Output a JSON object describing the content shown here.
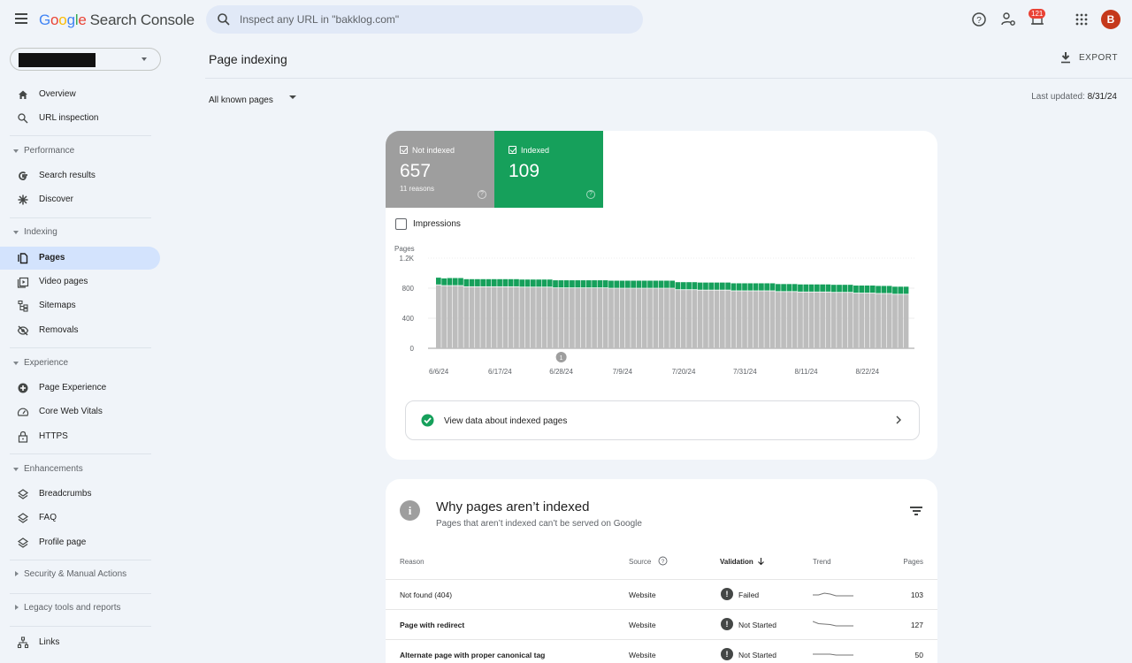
{
  "app": {
    "logo_parts": [
      "G",
      "o",
      "o",
      "g",
      "l",
      "e"
    ],
    "product": "Search Console",
    "search_placeholder": "Inspect any URL in \"bakklog.com\"",
    "notification_count": "121",
    "avatar_initial": "B",
    "icons": [
      "help-icon",
      "account-settings-icon",
      "notifications-icon",
      "apps-grid-icon"
    ]
  },
  "sidebar": {
    "property_selector": "[redacted]",
    "top_items": [
      {
        "label": "Overview",
        "icon": "home-icon"
      },
      {
        "label": "URL inspection",
        "icon": "search-icon"
      }
    ],
    "sections": [
      {
        "label": "Performance",
        "expanded": true,
        "items": [
          {
            "label": "Search results",
            "icon": "google-g-icon"
          },
          {
            "label": "Discover",
            "icon": "asterisk-icon"
          }
        ]
      },
      {
        "label": "Indexing",
        "expanded": true,
        "items": [
          {
            "label": "Pages",
            "icon": "pages-icon",
            "active": true
          },
          {
            "label": "Video pages",
            "icon": "video-pages-icon"
          },
          {
            "label": "Sitemaps",
            "icon": "sitemap-icon"
          },
          {
            "label": "Removals",
            "icon": "eye-off-icon"
          }
        ]
      },
      {
        "label": "Experience",
        "expanded": true,
        "items": [
          {
            "label": "Page Experience",
            "icon": "plus-circle-icon"
          },
          {
            "label": "Core Web Vitals",
            "icon": "gauge-icon"
          },
          {
            "label": "HTTPS",
            "icon": "lock-icon"
          }
        ]
      },
      {
        "label": "Enhancements",
        "expanded": true,
        "items": [
          {
            "label": "Breadcrumbs",
            "icon": "layers-icon"
          },
          {
            "label": "FAQ",
            "icon": "layers-icon"
          },
          {
            "label": "Profile page",
            "icon": "layers-icon"
          }
        ]
      },
      {
        "label": "Security & Manual Actions",
        "expanded": false,
        "items": []
      },
      {
        "label": "Legacy tools and reports",
        "expanded": false,
        "items": []
      }
    ],
    "bottom_items": [
      {
        "label": "Links",
        "icon": "links-icon"
      }
    ]
  },
  "main": {
    "title": "Page indexing",
    "export_label": "EXPORT",
    "filter_label": "All known pages",
    "last_updated_label": "Last updated:",
    "last_updated_value": "8/31/24",
    "summary": {
      "not_indexed": {
        "label": "Not indexed",
        "value": "657",
        "sub": "11 reasons",
        "checked": true,
        "color": "#9e9e9e"
      },
      "indexed": {
        "label": "Indexed",
        "value": "109",
        "checked": true,
        "color": "#16a05b"
      }
    },
    "impressions_label": "Impressions",
    "impressions_checked": false,
    "view_data_label": "View data about indexed pages",
    "why": {
      "title": "Why pages aren’t indexed",
      "subtitle": "Pages that aren’t indexed can’t be served on Google",
      "columns": {
        "reason": "Reason",
        "source": "Source",
        "validation": "Validation",
        "trend": "Trend",
        "pages": "Pages"
      },
      "rows": [
        {
          "reason": "Not found (404)",
          "source": "Website",
          "validation": "Failed",
          "pages": "103",
          "bold": false,
          "trend": [
            0.6,
            0.6,
            0.4,
            0.5,
            0.7,
            0.7,
            0.7,
            0.7
          ]
        },
        {
          "reason": "Page with redirect",
          "source": "Website",
          "validation": "Not Started",
          "pages": "127",
          "bold": true,
          "trend": [
            0.2,
            0.45,
            0.5,
            0.55,
            0.7,
            0.7,
            0.7,
            0.7
          ]
        },
        {
          "reason": "Alternate page with proper canonical tag",
          "source": "Website",
          "validation": "Not Started",
          "pages": "50",
          "bold": true,
          "trend": [
            0.5,
            0.5,
            0.5,
            0.5,
            0.6,
            0.6,
            0.6,
            0.6
          ]
        }
      ]
    }
  },
  "chart_data": {
    "type": "bar",
    "stacked": true,
    "ylabel": "Pages",
    "ylim": [
      0,
      1200
    ],
    "yticks": [
      "0",
      "400",
      "800",
      "1.2K"
    ],
    "ytick_values": [
      0,
      400,
      800,
      1200
    ],
    "xticks": [
      "6/6/24",
      "6/17/24",
      "6/28/24",
      "7/9/24",
      "7/20/24",
      "7/31/24",
      "8/11/24",
      "8/22/24"
    ],
    "xtick_indices": [
      0,
      11,
      22,
      33,
      44,
      55,
      66,
      77
    ],
    "annotation": {
      "label": "1",
      "index": 22
    },
    "grid": true,
    "colors": {
      "not_indexed": "#bdbdbd",
      "indexed": "#16a05b"
    },
    "series": [
      {
        "name": "Not indexed",
        "values": [
          840,
          830,
          830,
          830,
          830,
          815,
          815,
          815,
          815,
          815,
          815,
          815,
          815,
          815,
          815,
          810,
          810,
          810,
          810,
          810,
          810,
          800,
          800,
          800,
          800,
          800,
          800,
          800,
          800,
          800,
          800,
          795,
          795,
          795,
          795,
          795,
          795,
          795,
          795,
          795,
          795,
          795,
          795,
          775,
          775,
          775,
          775,
          770,
          770,
          770,
          770,
          770,
          770,
          760,
          760,
          760,
          760,
          760,
          760,
          760,
          760,
          750,
          750,
          750,
          750,
          745,
          745,
          745,
          745,
          745,
          745,
          740,
          740,
          740,
          740,
          730,
          730,
          730,
          730,
          725,
          725,
          725,
          715,
          715,
          715,
          715,
          705,
          705,
          705,
          705,
          700,
          700,
          700,
          700,
          695,
          695,
          695,
          690,
          690,
          690,
          690,
          690,
          690,
          685,
          685,
          685,
          685,
          685,
          675,
          675,
          675,
          675,
          675,
          675,
          670,
          670
        ]
      },
      {
        "name": "Indexed",
        "values": [
          100,
          100,
          105,
          105,
          105,
          105,
          105,
          105,
          105,
          105,
          105,
          105,
          105,
          105,
          105,
          105,
          105,
          105,
          105,
          105,
          105,
          105,
          105,
          105,
          105,
          105,
          105,
          105,
          105,
          105,
          105,
          105,
          105,
          105,
          105,
          105,
          105,
          105,
          105,
          105,
          105,
          105,
          105,
          105,
          105,
          105,
          105,
          105,
          105,
          105,
          105,
          105,
          105,
          105,
          105,
          105,
          105,
          105,
          105,
          105,
          105,
          105,
          105,
          105,
          105,
          105,
          105,
          105,
          105,
          105,
          105,
          105,
          105,
          105,
          105,
          105,
          105,
          105,
          105,
          105,
          105,
          105,
          105,
          105,
          105,
          105,
          105,
          105,
          105,
          105,
          105,
          105,
          105,
          105,
          105,
          105,
          105,
          105,
          105,
          105,
          105,
          105,
          105,
          105,
          105,
          105,
          105,
          105,
          105,
          105,
          105,
          105,
          105,
          105,
          105,
          105
        ]
      }
    ]
  }
}
